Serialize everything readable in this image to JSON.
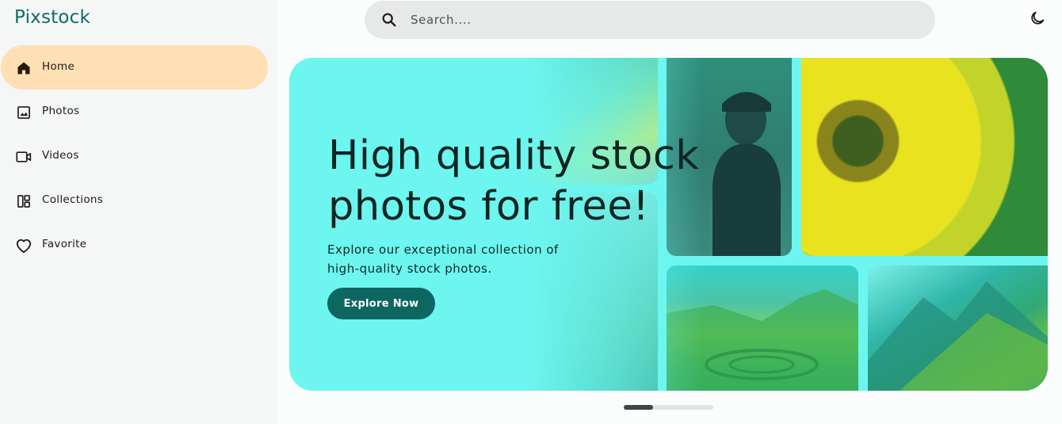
{
  "app": {
    "logo": "Pixstock"
  },
  "sidebar": {
    "items": [
      {
        "label": "Home",
        "icon": "home-icon",
        "active": true
      },
      {
        "label": "Photos",
        "icon": "image-icon",
        "active": false
      },
      {
        "label": "Videos",
        "icon": "video-icon",
        "active": false
      },
      {
        "label": "Collections",
        "icon": "collections-icon",
        "active": false
      },
      {
        "label": "Favorite",
        "icon": "heart-icon",
        "active": false
      }
    ]
  },
  "search": {
    "placeholder": "Search....",
    "value": ""
  },
  "hero": {
    "title": "High quality stock photos for free!",
    "subtitle": "Explore our exceptional collection of high-quality stock photos.",
    "cta_label": "Explore Now"
  },
  "carousel": {
    "progress_fraction": 0.33
  },
  "colors": {
    "brand": "#0f6b64",
    "active_nav": "#ffdfb4",
    "hero_bg": "#6df5ef",
    "cta": "#0d6660"
  }
}
